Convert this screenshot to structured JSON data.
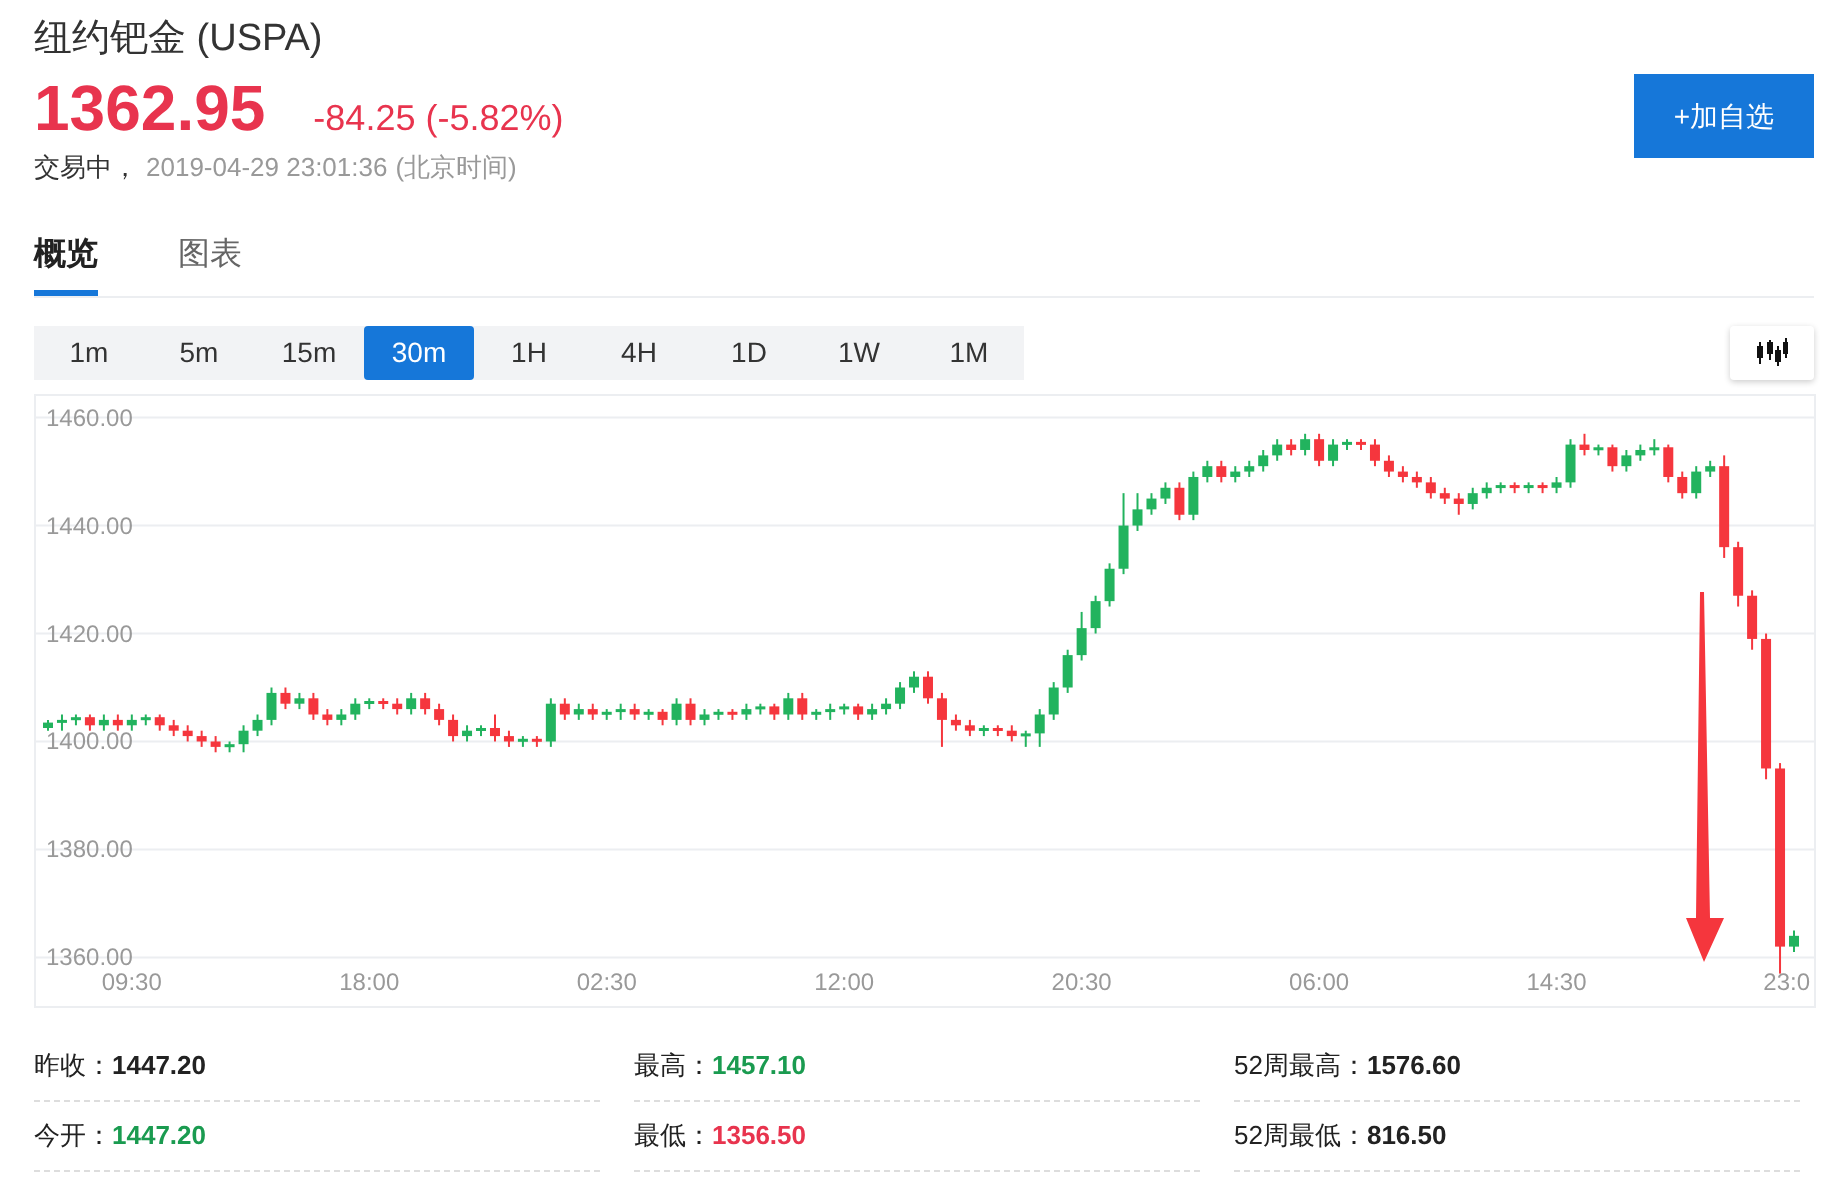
{
  "header": {
    "title": "纽约钯金 (USPA)",
    "price": "1362.95",
    "change": "-84.25 (-5.82%)",
    "status": "交易中，",
    "time": "2019-04-29 23:01:36",
    "timezone": "(北京时间)",
    "button": "+加自选"
  },
  "tabs": [
    {
      "label": "概览",
      "selected": true
    },
    {
      "label": "图表",
      "selected": false
    }
  ],
  "periods": [
    {
      "label": "1m",
      "selected": false
    },
    {
      "label": "5m",
      "selected": false
    },
    {
      "label": "15m",
      "selected": false
    },
    {
      "label": "30m",
      "selected": true
    },
    {
      "label": "1H",
      "selected": false
    },
    {
      "label": "4H",
      "selected": false
    },
    {
      "label": "1D",
      "selected": false
    },
    {
      "label": "1W",
      "selected": false
    },
    {
      "label": "1M",
      "selected": false
    }
  ],
  "candlestick_toggle": {
    "selected": true
  },
  "chart": {
    "chart_data": {
      "type": "candlestick",
      "grid": true,
      "ylim": [
        1351,
        1464
      ],
      "yticks": [
        {
          "value": 1460,
          "label": "1460.00"
        },
        {
          "value": 1440,
          "label": "1440.00"
        },
        {
          "value": 1420,
          "label": "1420.00"
        },
        {
          "value": 1400,
          "label": "1400.00"
        },
        {
          "value": 1380,
          "label": "1380.00"
        },
        {
          "value": 1360,
          "label": "1360.00"
        }
      ],
      "categories": [
        null,
        null,
        null,
        null,
        null,
        null,
        "09:30",
        null,
        null,
        null,
        null,
        null,
        null,
        null,
        null,
        null,
        null,
        null,
        null,
        null,
        null,
        null,
        null,
        "18:00",
        null,
        null,
        null,
        null,
        null,
        null,
        null,
        null,
        null,
        null,
        null,
        null,
        null,
        null,
        null,
        null,
        "02:30",
        null,
        null,
        null,
        null,
        null,
        null,
        null,
        null,
        null,
        null,
        null,
        null,
        null,
        null,
        null,
        null,
        "12:00",
        null,
        null,
        null,
        null,
        null,
        null,
        null,
        null,
        null,
        null,
        null,
        null,
        null,
        null,
        null,
        null,
        "20:30",
        null,
        null,
        null,
        null,
        null,
        null,
        null,
        null,
        null,
        null,
        null,
        null,
        null,
        null,
        null,
        null,
        "06:00",
        null,
        null,
        null,
        null,
        null,
        null,
        null,
        null,
        null,
        null,
        null,
        null,
        null,
        null,
        null,
        null,
        "14:30",
        null,
        null,
        null,
        null,
        null,
        null,
        null,
        null,
        null,
        null,
        null,
        null,
        null,
        null,
        null,
        null,
        "23:0"
      ],
      "ohlc": [
        [
          1402.5,
          1404,
          1402,
          1403.5
        ],
        [
          1403.5,
          1405,
          1402,
          1404
        ],
        [
          1404,
          1405,
          1403,
          1404.5
        ],
        [
          1404.5,
          1405,
          1402,
          1403
        ],
        [
          1403,
          1405,
          1402,
          1404
        ],
        [
          1404,
          1405,
          1402,
          1403
        ],
        [
          1403,
          1405,
          1402,
          1404
        ],
        [
          1404,
          1405,
          1403,
          1404.5
        ],
        [
          1404.5,
          1405,
          1402,
          1403
        ],
        [
          1403,
          1404,
          1401,
          1402
        ],
        [
          1402,
          1403,
          1400,
          1401
        ],
        [
          1401,
          1402,
          1399,
          1400
        ],
        [
          1400,
          1401,
          1398,
          1399
        ],
        [
          1399,
          1400,
          1398,
          1399.5
        ],
        [
          1399.5,
          1403,
          1398,
          1402
        ],
        [
          1402,
          1405,
          1401,
          1404
        ],
        [
          1404,
          1410,
          1403,
          1409
        ],
        [
          1409,
          1410,
          1406,
          1407
        ],
        [
          1407,
          1409,
          1406,
          1408
        ],
        [
          1408,
          1409,
          1404,
          1405
        ],
        [
          1405,
          1406,
          1403,
          1404
        ],
        [
          1404,
          1406,
          1403,
          1405
        ],
        [
          1405,
          1408,
          1404,
          1407
        ],
        [
          1407,
          1408,
          1406,
          1407.5
        ],
        [
          1407.5,
          1408,
          1406,
          1407
        ],
        [
          1407,
          1408,
          1405,
          1406
        ],
        [
          1406,
          1409,
          1405,
          1408
        ],
        [
          1408,
          1409,
          1405,
          1406
        ],
        [
          1406,
          1407,
          1403,
          1404
        ],
        [
          1404,
          1405,
          1400,
          1401
        ],
        [
          1401,
          1403,
          1400,
          1402
        ],
        [
          1402,
          1403,
          1401,
          1402.5
        ],
        [
          1402.5,
          1405,
          1400,
          1401
        ],
        [
          1401,
          1402,
          1399,
          1400
        ],
        [
          1400,
          1401,
          1399,
          1400.5
        ],
        [
          1400.5,
          1401,
          1399,
          1400
        ],
        [
          1400,
          1408,
          1399,
          1407
        ],
        [
          1407,
          1408,
          1404,
          1405
        ],
        [
          1405,
          1407,
          1404,
          1406
        ],
        [
          1406,
          1407,
          1404,
          1405
        ],
        [
          1405,
          1406,
          1404,
          1405.5
        ],
        [
          1405.5,
          1407,
          1404,
          1406
        ],
        [
          1406,
          1407,
          1404,
          1405
        ],
        [
          1405,
          1406,
          1404,
          1405.5
        ],
        [
          1405.5,
          1406,
          1403,
          1404
        ],
        [
          1404,
          1408,
          1403,
          1407
        ],
        [
          1407,
          1408,
          1403,
          1404
        ],
        [
          1404,
          1406,
          1403,
          1405
        ],
        [
          1405,
          1406,
          1404,
          1405.5
        ],
        [
          1405.5,
          1406,
          1404,
          1405
        ],
        [
          1405,
          1407,
          1404,
          1406
        ],
        [
          1406,
          1407,
          1405,
          1406.5
        ],
        [
          1406.5,
          1407,
          1404,
          1405
        ],
        [
          1405,
          1409,
          1404,
          1408
        ],
        [
          1408,
          1409,
          1404,
          1405
        ],
        [
          1405,
          1406,
          1404,
          1405.5
        ],
        [
          1405.5,
          1407,
          1404,
          1406
        ],
        [
          1406,
          1407,
          1405,
          1406.5
        ],
        [
          1406.5,
          1407,
          1404,
          1405
        ],
        [
          1405,
          1407,
          1404,
          1406
        ],
        [
          1406,
          1408,
          1405,
          1407
        ],
        [
          1407,
          1411,
          1406,
          1410
        ],
        [
          1410,
          1413,
          1409,
          1412
        ],
        [
          1412,
          1413,
          1407,
          1408
        ],
        [
          1408,
          1409,
          1399,
          1404
        ],
        [
          1404,
          1405,
          1402,
          1403
        ],
        [
          1403,
          1404,
          1401,
          1402
        ],
        [
          1402,
          1403,
          1401,
          1402.5
        ],
        [
          1402.5,
          1403,
          1401,
          1402
        ],
        [
          1402,
          1403,
          1400,
          1401
        ],
        [
          1401,
          1402,
          1399,
          1401.5
        ],
        [
          1401.5,
          1406,
          1399,
          1405
        ],
        [
          1405,
          1411,
          1404,
          1410
        ],
        [
          1410,
          1417,
          1409,
          1416
        ],
        [
          1416,
          1424,
          1415,
          1421
        ],
        [
          1421,
          1427,
          1420,
          1426
        ],
        [
          1426,
          1433,
          1425,
          1432
        ],
        [
          1432,
          1446,
          1431,
          1440
        ],
        [
          1440,
          1446,
          1439,
          1443
        ],
        [
          1443,
          1446,
          1442,
          1445
        ],
        [
          1445,
          1448,
          1444,
          1447
        ],
        [
          1447,
          1448,
          1441,
          1442
        ],
        [
          1442,
          1450,
          1441,
          1449
        ],
        [
          1449,
          1452,
          1448,
          1451
        ],
        [
          1451,
          1452,
          1448,
          1449
        ],
        [
          1449,
          1451,
          1448,
          1450
        ],
        [
          1450,
          1452,
          1449,
          1451
        ],
        [
          1451,
          1454,
          1450,
          1453
        ],
        [
          1453,
          1456,
          1452,
          1455
        ],
        [
          1455,
          1456,
          1453,
          1454
        ],
        [
          1454,
          1457,
          1453,
          1456
        ],
        [
          1456,
          1457,
          1451,
          1452
        ],
        [
          1452,
          1456,
          1451,
          1455
        ],
        [
          1455,
          1456,
          1454,
          1455.5
        ],
        [
          1455.5,
          1456,
          1454,
          1455
        ],
        [
          1455,
          1456,
          1451,
          1452
        ],
        [
          1452,
          1453,
          1449,
          1450
        ],
        [
          1450,
          1451,
          1448,
          1449
        ],
        [
          1449,
          1450,
          1447,
          1448
        ],
        [
          1448,
          1449,
          1445,
          1446
        ],
        [
          1446,
          1447,
          1444,
          1445
        ],
        [
          1445,
          1446,
          1442,
          1444
        ],
        [
          1444,
          1447,
          1443,
          1446
        ],
        [
          1446,
          1448,
          1445,
          1447
        ],
        [
          1447,
          1448,
          1446,
          1447.5
        ],
        [
          1447.5,
          1448,
          1446,
          1447
        ],
        [
          1447,
          1448,
          1446,
          1447.5
        ],
        [
          1447.5,
          1448,
          1446,
          1447
        ],
        [
          1447,
          1449,
          1446,
          1448
        ],
        [
          1448,
          1456,
          1447,
          1455
        ],
        [
          1455,
          1457,
          1453,
          1454
        ],
        [
          1454,
          1455,
          1453,
          1454.5
        ],
        [
          1454.5,
          1455,
          1450,
          1451
        ],
        [
          1451,
          1454,
          1450,
          1453
        ],
        [
          1453,
          1455,
          1452,
          1454
        ],
        [
          1454,
          1456,
          1453,
          1454.5
        ],
        [
          1454.5,
          1455,
          1448,
          1449
        ],
        [
          1449,
          1450,
          1445,
          1446
        ],
        [
          1446,
          1451,
          1445,
          1450
        ],
        [
          1450,
          1452,
          1449,
          1451
        ],
        [
          1451,
          1453,
          1434,
          1436
        ],
        [
          1436,
          1437,
          1425,
          1427
        ],
        [
          1427,
          1428,
          1417,
          1419
        ],
        [
          1419,
          1420,
          1393,
          1395
        ],
        [
          1395,
          1396,
          1357,
          1362
        ],
        [
          1362,
          1365,
          1361,
          1364
        ]
      ]
    }
  },
  "stats": [
    {
      "label": "昨收：",
      "value": "1447.20",
      "color": "#222222"
    },
    {
      "label": "最高：",
      "value": "1457.10",
      "color": "#1a9b50"
    },
    {
      "label": "52周最高：",
      "value": "1576.60",
      "color": "#222222"
    },
    {
      "label": "今开：",
      "value": "1447.20",
      "color": "#1a9b50"
    },
    {
      "label": "最低：",
      "value": "1356.50",
      "color": "#e8344e"
    },
    {
      "label": "52周最低：",
      "value": "816.50",
      "color": "#222222"
    }
  ]
}
